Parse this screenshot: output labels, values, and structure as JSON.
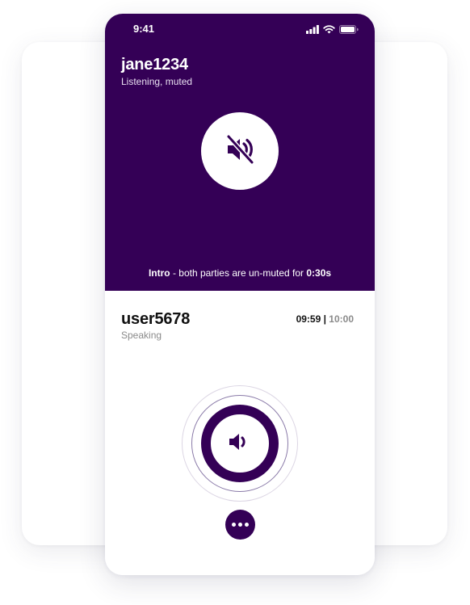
{
  "status_bar": {
    "time": "9:41"
  },
  "top": {
    "username": "jane1234",
    "status": "Listening, muted",
    "intro_label": "Intro",
    "intro_text": " - both parties are un-muted for ",
    "intro_time": "0:30s"
  },
  "bottom": {
    "username": "user5678",
    "status": "Speaking",
    "timer_elapsed": "09:59",
    "timer_sep": " | ",
    "timer_total": "10:00"
  },
  "colors": {
    "primary": "#340056",
    "background": "#ffffff",
    "secondary_text": "#8a8a8a"
  },
  "icons": {
    "mute": "speaker-muted-icon",
    "speaker": "speaker-icon",
    "more": "more-options-icon"
  }
}
